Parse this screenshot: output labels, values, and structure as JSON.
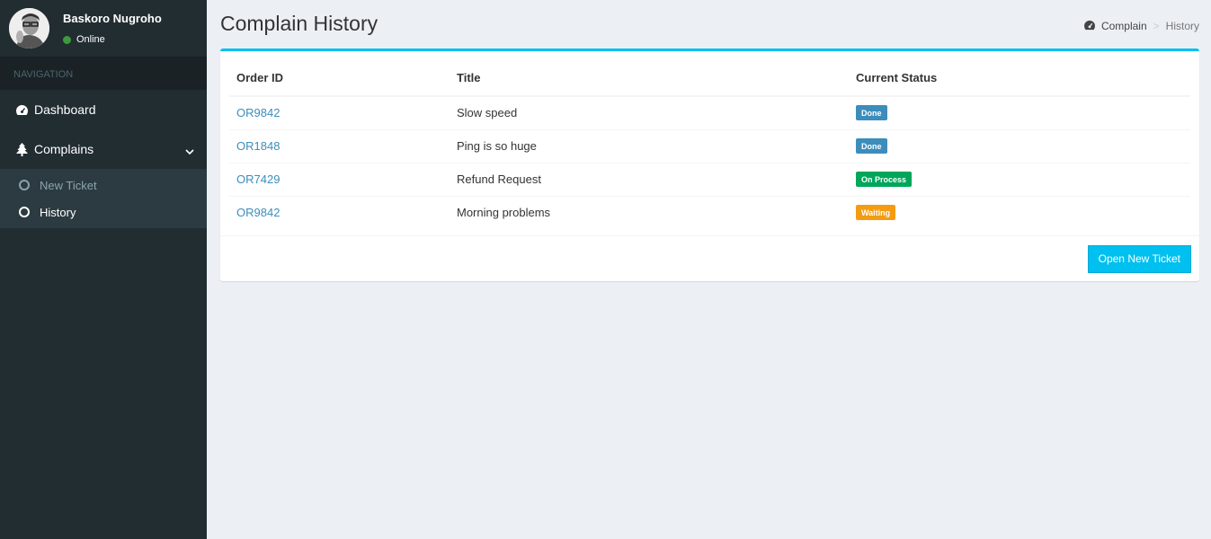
{
  "user": {
    "name": "Baskoro Nugroho",
    "status": "Online"
  },
  "nav": {
    "header": "NAVIGATION",
    "dashboard": "Dashboard",
    "complains": "Complains",
    "sub": [
      "New Ticket",
      "History"
    ]
  },
  "page": {
    "title": "Complain History"
  },
  "breadcrumb": {
    "root": "Complain",
    "current": "History"
  },
  "table": {
    "headers": [
      "Order ID",
      "Title",
      "Current Status"
    ],
    "rows": [
      {
        "order_id": "OR9842",
        "title": "Slow speed",
        "status": "Done",
        "status_color": "#3c8dbc"
      },
      {
        "order_id": "OR1848",
        "title": "Ping is so huge",
        "status": "Done",
        "status_color": "#3c8dbc"
      },
      {
        "order_id": "OR7429",
        "title": "Refund Request",
        "status": "On Process",
        "status_color": "#00a65a"
      },
      {
        "order_id": "OR9842",
        "title": "Morning problems",
        "status": "Waiting",
        "status_color": "#f39c12"
      }
    ]
  },
  "footer": {
    "button": "Open New Ticket"
  },
  "colors": {
    "sidebar": "#222d32",
    "accent": "#00c0ef",
    "link": "#3c8dbc"
  }
}
